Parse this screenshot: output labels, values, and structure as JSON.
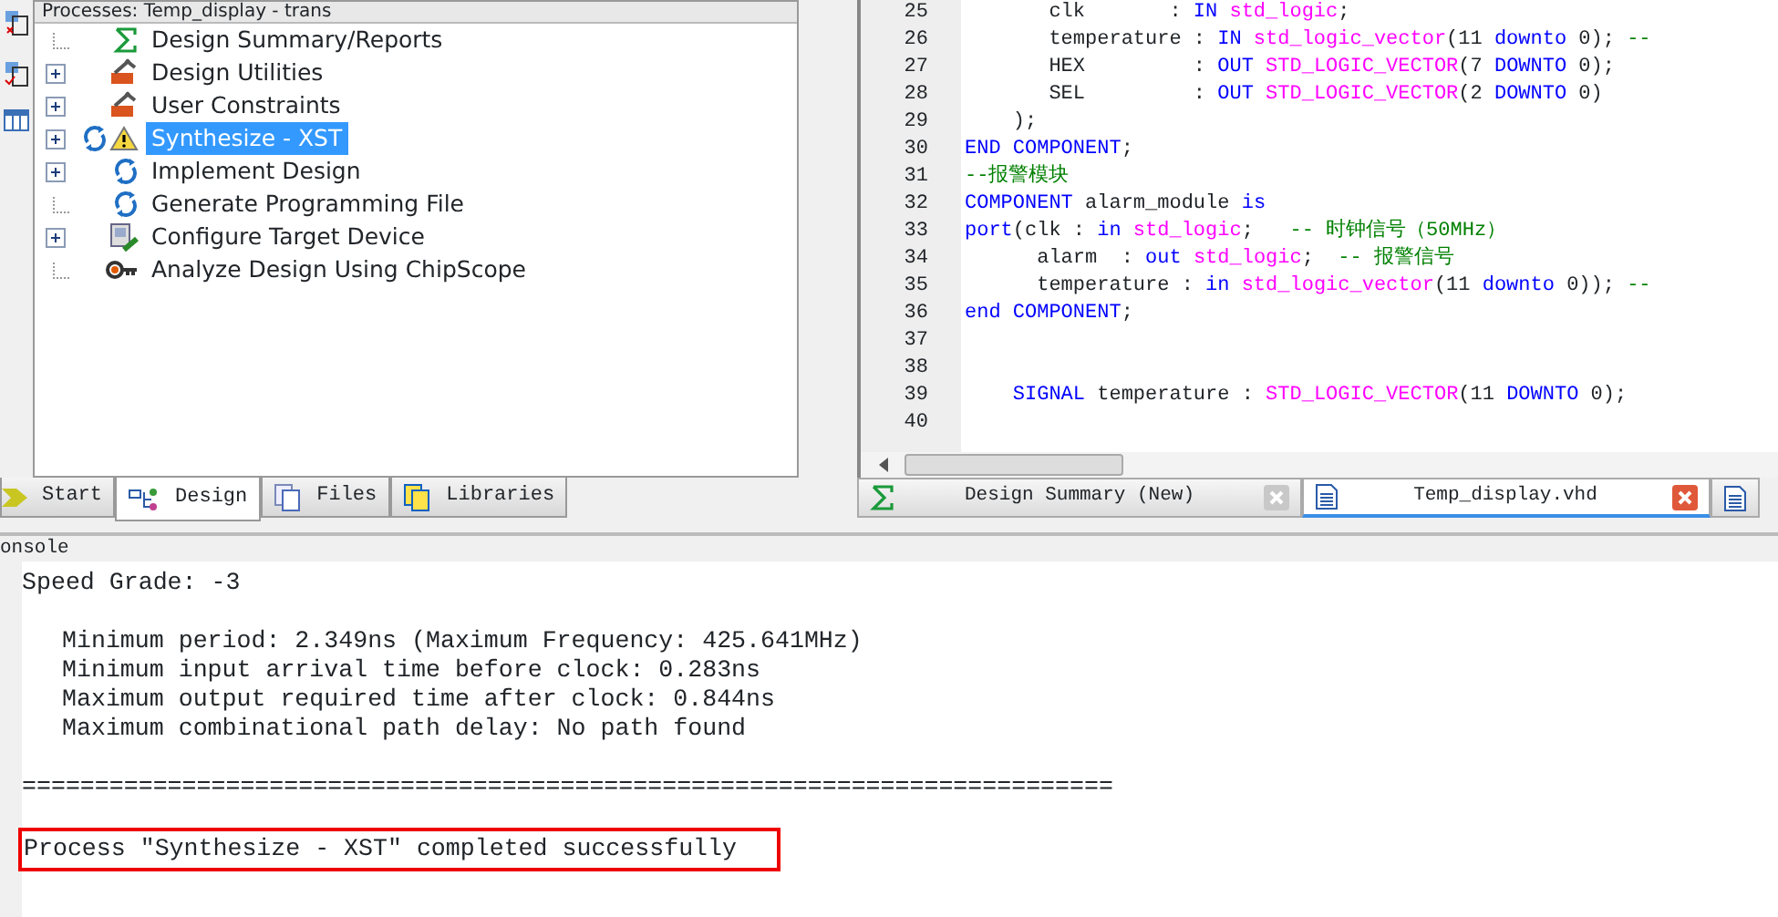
{
  "processes_panel": {
    "title": "Processes: Temp_display - trans",
    "items": [
      {
        "label": "Design Summary/Reports",
        "kind": "sigma",
        "expandable": false,
        "selected": false
      },
      {
        "label": "Design Utilities",
        "kind": "tools",
        "expandable": true,
        "selected": false
      },
      {
        "label": "User Constraints",
        "kind": "tools",
        "expandable": true,
        "selected": false
      },
      {
        "label": "Synthesize - XST",
        "kind": "run-warning",
        "expandable": true,
        "selected": true
      },
      {
        "label": "Implement Design",
        "kind": "run",
        "expandable": true,
        "selected": false
      },
      {
        "label": "Generate Programming File",
        "kind": "run",
        "expandable": false,
        "selected": false
      },
      {
        "label": "Configure Target Device",
        "kind": "device",
        "expandable": true,
        "selected": false
      },
      {
        "label": "Analyze Design Using ChipScope",
        "kind": "probe",
        "expandable": false,
        "selected": false
      }
    ]
  },
  "left_tabs": [
    {
      "label": "Start",
      "kind": "start",
      "selected": false
    },
    {
      "label": "Design",
      "kind": "design",
      "selected": true
    },
    {
      "label": "Files",
      "kind": "files",
      "selected": false
    },
    {
      "label": "Libraries",
      "kind": "libraries",
      "selected": false
    }
  ],
  "editor": {
    "lines": [
      {
        "number": "25",
        "tokens": [
          {
            "kind": "plain",
            "text": "       clk       : "
          },
          {
            "kind": "kw",
            "text": "IN"
          },
          {
            "kind": "type",
            "text": " std_logic"
          },
          {
            "kind": "plain",
            "text": ";"
          }
        ]
      },
      {
        "number": "26",
        "tokens": [
          {
            "kind": "plain",
            "text": "       temperature : "
          },
          {
            "kind": "kw",
            "text": "IN"
          },
          {
            "kind": "type",
            "text": " std_logic_vector"
          },
          {
            "kind": "plain",
            "text": "(11 "
          },
          {
            "kind": "kw",
            "text": "downto"
          },
          {
            "kind": "plain",
            "text": " 0); "
          },
          {
            "kind": "comment",
            "text": "--"
          }
        ]
      },
      {
        "number": "27",
        "tokens": [
          {
            "kind": "plain",
            "text": "       HEX         : "
          },
          {
            "kind": "kw",
            "text": "OUT"
          },
          {
            "kind": "type",
            "text": " STD_LOGIC_VECTOR"
          },
          {
            "kind": "plain",
            "text": "(7 "
          },
          {
            "kind": "kw",
            "text": "DOWNTO"
          },
          {
            "kind": "plain",
            "text": " 0);"
          }
        ]
      },
      {
        "number": "28",
        "tokens": [
          {
            "kind": "plain",
            "text": "       SEL         : "
          },
          {
            "kind": "kw",
            "text": "OUT"
          },
          {
            "kind": "type",
            "text": " STD_LOGIC_VECTOR"
          },
          {
            "kind": "plain",
            "text": "(2 "
          },
          {
            "kind": "kw",
            "text": "DOWNTO"
          },
          {
            "kind": "plain",
            "text": " 0)"
          }
        ]
      },
      {
        "number": "29",
        "tokens": [
          {
            "kind": "plain",
            "text": "    );"
          }
        ]
      },
      {
        "number": "30",
        "tokens": [
          {
            "kind": "kw",
            "text": "END COMPONENT"
          },
          {
            "kind": "plain",
            "text": ";"
          }
        ]
      },
      {
        "number": "31",
        "tokens": [
          {
            "kind": "comment",
            "text": "--报警模块"
          }
        ]
      },
      {
        "number": "32",
        "tokens": [
          {
            "kind": "kw",
            "text": "COMPONENT"
          },
          {
            "kind": "plain",
            "text": " alarm_module "
          },
          {
            "kind": "kw",
            "text": "is"
          }
        ]
      },
      {
        "number": "33",
        "tokens": [
          {
            "kind": "kw",
            "text": "port"
          },
          {
            "kind": "plain",
            "text": "(clk : "
          },
          {
            "kind": "kw",
            "text": "in"
          },
          {
            "kind": "type",
            "text": " std_logic"
          },
          {
            "kind": "plain",
            "text": ";   "
          },
          {
            "kind": "comment",
            "text": "-- 时钟信号（50MHz）"
          }
        ]
      },
      {
        "number": "34",
        "tokens": [
          {
            "kind": "plain",
            "text": "      alarm  : "
          },
          {
            "kind": "kw",
            "text": "out"
          },
          {
            "kind": "type",
            "text": " std_logic"
          },
          {
            "kind": "plain",
            "text": ";  "
          },
          {
            "kind": "comment",
            "text": "-- 报警信号"
          }
        ]
      },
      {
        "number": "35",
        "tokens": [
          {
            "kind": "plain",
            "text": "      temperature : "
          },
          {
            "kind": "kw",
            "text": "in"
          },
          {
            "kind": "type",
            "text": " std_logic_vector"
          },
          {
            "kind": "plain",
            "text": "(11 "
          },
          {
            "kind": "kw",
            "text": "downto"
          },
          {
            "kind": "plain",
            "text": " 0)); "
          },
          {
            "kind": "comment",
            "text": "--"
          }
        ]
      },
      {
        "number": "36",
        "tokens": [
          {
            "kind": "kw",
            "text": "end COMPONENT"
          },
          {
            "kind": "plain",
            "text": ";"
          }
        ]
      },
      {
        "number": "37"
      },
      {
        "number": "38"
      },
      {
        "number": "39",
        "tokens": [
          {
            "kind": "kw",
            "text": "    SIGNAL"
          },
          {
            "kind": "plain",
            "text": " temperature : "
          },
          {
            "kind": "type",
            "text": "STD_LOGIC_VECTOR"
          },
          {
            "kind": "plain",
            "text": "(11 "
          },
          {
            "kind": "kw",
            "text": "DOWNTO"
          },
          {
            "kind": "plain",
            "text": " 0);"
          }
        ]
      },
      {
        "number": "40"
      }
    ]
  },
  "editor_tabs": [
    {
      "label": "Design Summary (New)",
      "kind": "summary",
      "selected": false
    },
    {
      "label": "Temp_display.vhd",
      "kind": "file",
      "selected": true
    },
    {
      "kind": "file",
      "selected": false
    }
  ],
  "console": {
    "title": "onsole",
    "blocks": [
      {
        "indented": false,
        "lines": [
          {
            "text": "Speed Grade: -3",
            "highlighted": false
          }
        ]
      },
      {
        "indented": true,
        "lines": [
          {
            "text": "Minimum period: 2.349ns (Maximum Frequency: 425.641MHz)",
            "highlighted": false
          },
          {
            "text": "Minimum input arrival time before clock: 0.283ns",
            "highlighted": false
          },
          {
            "text": "Maximum output required time after clock: 0.844ns",
            "highlighted": false
          },
          {
            "text": "Maximum combinational path delay: No path found",
            "highlighted": false
          }
        ]
      },
      {
        "indented": false,
        "lines": [
          {
            "text": "===========================================================================",
            "highlighted": false
          }
        ]
      },
      {
        "indented": false,
        "lines": [
          {
            "text": "Process \"Synthesize - XST\" completed successfully",
            "highlighted": true
          }
        ]
      }
    ]
  }
}
